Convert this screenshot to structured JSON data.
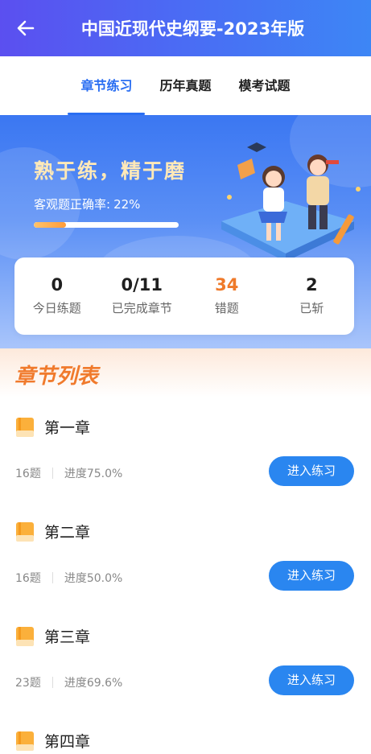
{
  "header": {
    "title": "中国近现代史纲要-2023年版",
    "back_icon": "arrow-left-icon"
  },
  "tabs": [
    {
      "label": "章节练习",
      "active": true
    },
    {
      "label": "历年真题",
      "active": false
    },
    {
      "label": "模考试题",
      "active": false
    }
  ],
  "banner": {
    "slogan": "熟于练，精于磨",
    "accuracy_label": "客观题正确率:",
    "accuracy_value": "22%",
    "accuracy_fraction": 0.22
  },
  "stats": [
    {
      "value": "0",
      "label": "今日练题",
      "highlight": false
    },
    {
      "value": "0/11",
      "label": "已完成章节",
      "highlight": false
    },
    {
      "value": "34",
      "label": "错题",
      "highlight": true
    },
    {
      "value": "2",
      "label": "已斩",
      "highlight": false
    }
  ],
  "list": {
    "title": "章节列表",
    "button_label": "进入练习",
    "chapters": [
      {
        "name": "第一章",
        "count": "16题",
        "progress": "进度75.0%"
      },
      {
        "name": "第二章",
        "count": "16题",
        "progress": "进度50.0%"
      },
      {
        "name": "第三章",
        "count": "23题",
        "progress": "进度69.6%"
      },
      {
        "name": "第四章",
        "count": "",
        "progress": ""
      }
    ]
  },
  "colors": {
    "accent": "#2a6ef2",
    "orange": "#ef7a2a",
    "button": "#2a86f0"
  }
}
